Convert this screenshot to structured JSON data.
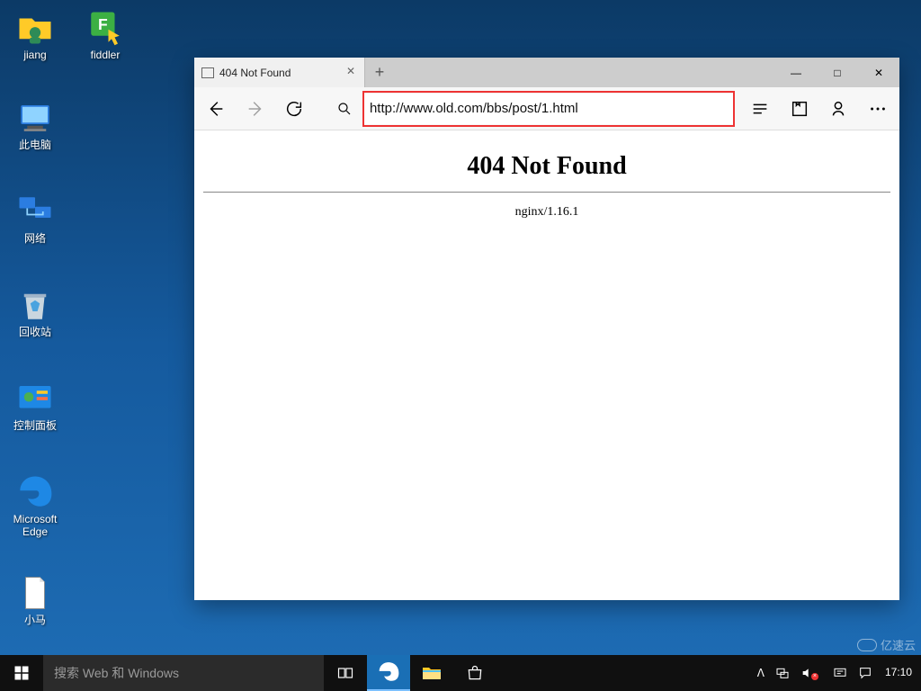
{
  "desktop": {
    "icons": [
      {
        "label": "jiang",
        "glyph": "user-folder"
      },
      {
        "label": "fiddler",
        "glyph": "fiddler"
      },
      {
        "label": "此电脑",
        "glyph": "pc"
      },
      {
        "label": "网络",
        "glyph": "network"
      },
      {
        "label": "回收站",
        "glyph": "recycle"
      },
      {
        "label": "控制面板",
        "glyph": "control-panel"
      },
      {
        "label": "Microsoft\nEdge",
        "glyph": "edge"
      },
      {
        "label": "小马",
        "glyph": "file"
      }
    ]
  },
  "browser": {
    "tab_title": "404 Not Found",
    "url": "http://www.old.com/bbs/post/1.html",
    "page": {
      "heading": "404 Not Found",
      "server": "nginx/1.16.1"
    },
    "window_controls": {
      "min": "—",
      "max": "□",
      "close": "✕"
    },
    "newtab_glyph": "+",
    "tab_close_glyph": "✕"
  },
  "taskbar": {
    "search_placeholder": "搜索 Web 和 Windows",
    "clock_time": "17:10",
    "tray_chevron": "ᐱ"
  },
  "watermark": {
    "text": "亿速云"
  }
}
